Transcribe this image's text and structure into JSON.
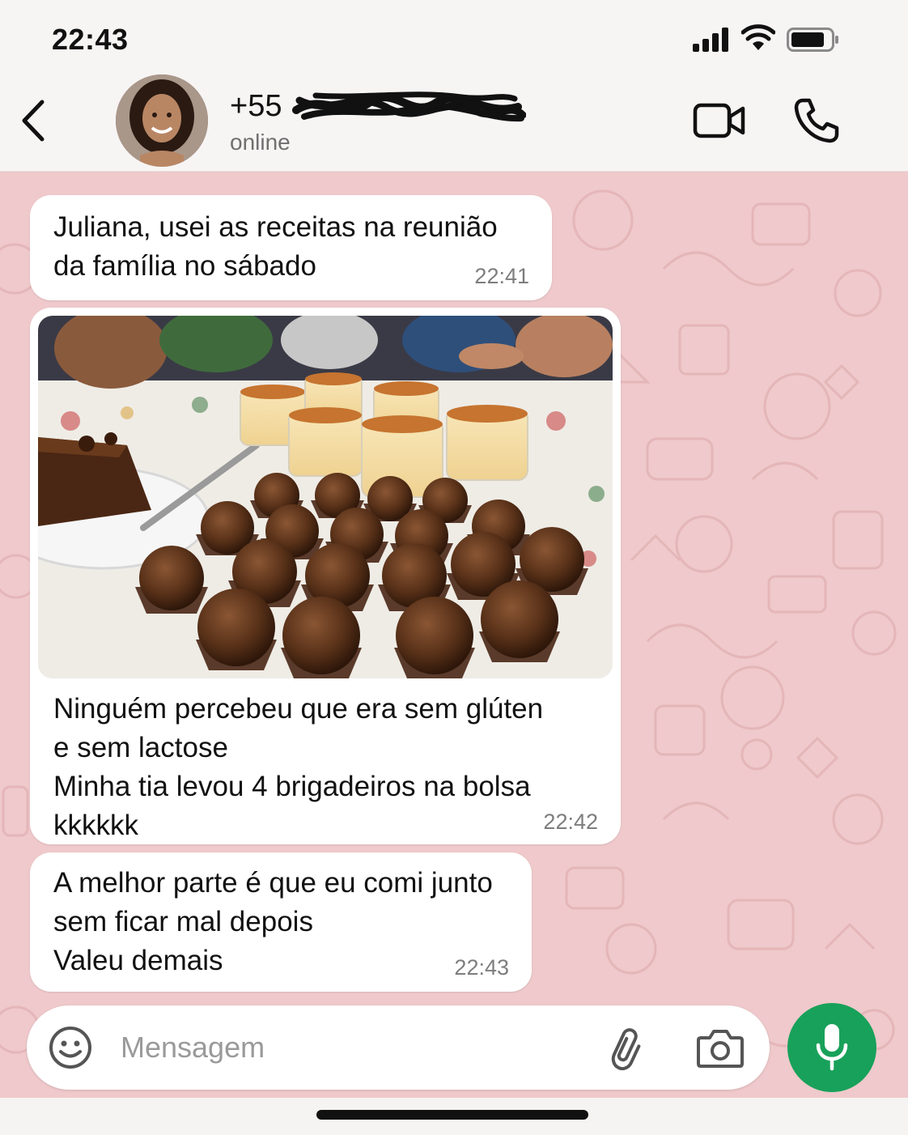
{
  "status_bar": {
    "time": "22:43",
    "icons": [
      "signal-icon",
      "wifi-icon",
      "battery-icon"
    ]
  },
  "header": {
    "contact_number_visible": "+55",
    "contact_status": "online",
    "icons": [
      "back-icon",
      "video-call-icon",
      "phone-call-icon"
    ]
  },
  "messages": [
    {
      "text": "Juliana, usei as receitas na reunião\nda família no sábado",
      "time": "22:41"
    },
    {
      "has_photo": true,
      "text": "Ninguém percebeu que era sem glúten\ne sem lactose\nMinha tia levou 4 brigadeiros na bolsa kkkkkk",
      "time": "22:42"
    },
    {
      "text": "A melhor parte é que eu comi junto\nsem ficar mal depois\nValeu demais",
      "time": "22:43"
    }
  ],
  "composer": {
    "placeholder": "Mensagem",
    "icons": [
      "emoji-icon",
      "attach-icon",
      "camera-icon",
      "mic-icon"
    ]
  },
  "colors": {
    "chat_background": "#efc9cb",
    "bubble": "#ffffff",
    "mic_button": "#18a15a"
  }
}
